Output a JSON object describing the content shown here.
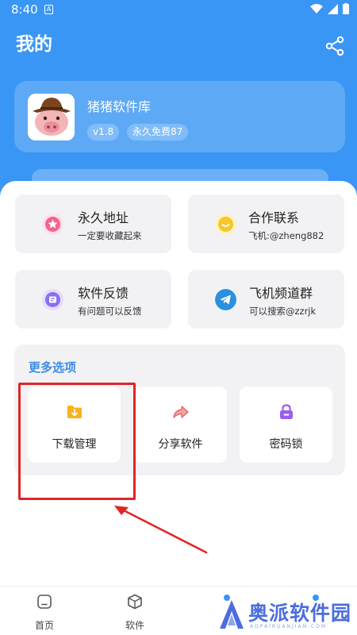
{
  "status_bar": {
    "time": "8:40",
    "app_icon_letter": "A"
  },
  "header": {
    "title": "我的",
    "share_icon": "share-icon"
  },
  "profile": {
    "name": "猪猪软件库",
    "version_badge": "v1.8",
    "membership_badge": "永久免费87",
    "avatar_icon": "pig-cowboy-avatar"
  },
  "tiles": [
    {
      "title": "永久地址",
      "subtitle": "一定要收藏起来",
      "icon": "star-icon",
      "color": "#f2638d"
    },
    {
      "title": "合作联系",
      "subtitle": "飞机:@zheng882",
      "icon": "chat-icon",
      "color": "#f7c62b"
    },
    {
      "title": "软件反馈",
      "subtitle": "有问题可以反馈",
      "icon": "feedback-icon",
      "color": "#8b6ff0"
    },
    {
      "title": "飞机频道群",
      "subtitle": "可以搜索@zzrjk",
      "icon": "telegram-icon",
      "color": "#2a90e0"
    }
  ],
  "more_options": {
    "title": "更多选项",
    "items": [
      {
        "label": "下载管理",
        "icon": "download-folder-icon",
        "color": "#f7b21e"
      },
      {
        "label": "分享软件",
        "icon": "share-arrow-icon",
        "color": "#f06b6b"
      },
      {
        "label": "密码锁",
        "icon": "lock-icon",
        "color": "#9a5cf0"
      }
    ]
  },
  "annotation": {
    "highlight_color": "#e02525"
  },
  "bottom_nav": {
    "items": [
      {
        "label": "首页",
        "icon": "home-icon"
      },
      {
        "label": "软件",
        "icon": "box-icon"
      }
    ]
  },
  "watermark": {
    "text": "奥派软件园",
    "sub": "AOPAIRUANJIAN.COM"
  }
}
